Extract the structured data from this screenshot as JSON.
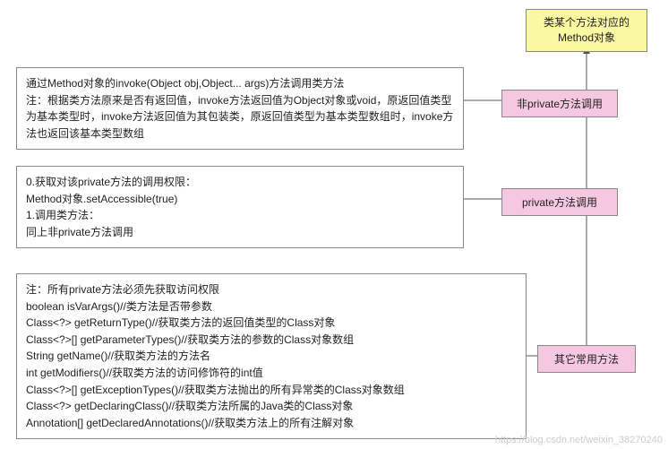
{
  "root": {
    "title": "类某个方法对应的Method对象"
  },
  "nodes": {
    "nonPrivate": {
      "label": "非private方法调用",
      "desc": "通过Method对象的invoke(Object obj,Object... args)方法调用类方法\n注：根据类方法原来是否有返回值，invoke方法返回值为Object对象或void，原返回值类型为基本类型时，invoke方法返回值为其包装类，原返回值类型为基本类型数组时，invoke方法也返回该基本类型数组"
    },
    "private": {
      "label": "private方法调用",
      "desc": "0.获取对该private方法的调用权限：\nMethod对象.setAccessible(true)\n1.调用类方法：\n同上非private方法调用"
    },
    "others": {
      "label": "其它常用方法",
      "desc": "注：所有private方法必须先获取访问权限\nboolean isVarArgs()//类方法是否带参数\nClass<?> getReturnType()//获取类方法的返回值类型的Class对象\nClass<?>[] getParameterTypes()//获取类方法的参数的Class对象数组\nString getName()//获取类方法的方法名\nint getModifiers()//获取类方法的访问修饰符的int值\nClass<?>[] getExceptionTypes()//获取类方法抛出的所有异常类的Class对象数组\nClass<?> getDeclaringClass()//获取类方法所属的Java类的Class对象\nAnnotation[] getDeclaredAnnotations()//获取类方法上的所有注解对象"
    }
  },
  "watermark": "https://blog.csdn.net/weixin_38270240"
}
